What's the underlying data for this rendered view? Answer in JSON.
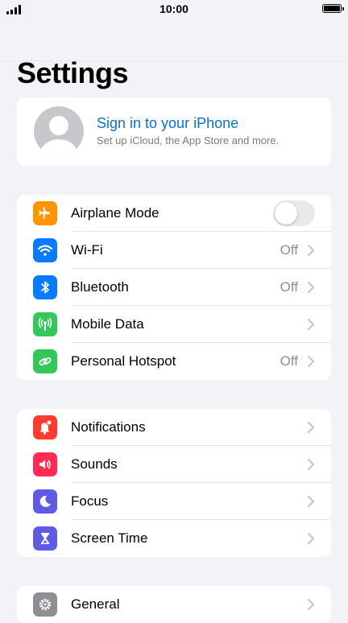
{
  "status": {
    "time": "10:00"
  },
  "title": "Settings",
  "profile": {
    "name": "Sign in to your iPhone",
    "subtitle": "Set up iCloud, the App Store and more."
  },
  "groups": [
    [
      {
        "label": "Airplane Mode",
        "icon": "airplane-icon",
        "color": "#ff9500",
        "control": "toggle",
        "toggle_on": false
      },
      {
        "label": "Wi-Fi",
        "icon": "wifi-icon",
        "color": "#0a7aff",
        "value": "Off"
      },
      {
        "label": "Bluetooth",
        "icon": "bluetooth-icon",
        "color": "#0a7aff",
        "value": "Off"
      },
      {
        "label": "Mobile Data",
        "icon": "antenna-icon",
        "color": "#34c759",
        "value": ""
      },
      {
        "label": "Personal Hotspot",
        "icon": "hotspot-icon",
        "color": "#34c759",
        "value": "Off"
      }
    ],
    [
      {
        "label": "Notifications",
        "icon": "bell-icon",
        "color": "#ff3b30",
        "value": ""
      },
      {
        "label": "Sounds",
        "icon": "speaker-icon",
        "color": "#ff2d55",
        "value": ""
      },
      {
        "label": "Focus",
        "icon": "moon-icon",
        "color": "#5e5ce6",
        "value": ""
      },
      {
        "label": "Screen Time",
        "icon": "hourglass-icon",
        "color": "#5e5ce6",
        "value": ""
      }
    ],
    [
      {
        "label": "General",
        "icon": "gear-icon",
        "color": "#8e8e93",
        "value": ""
      }
    ]
  ]
}
